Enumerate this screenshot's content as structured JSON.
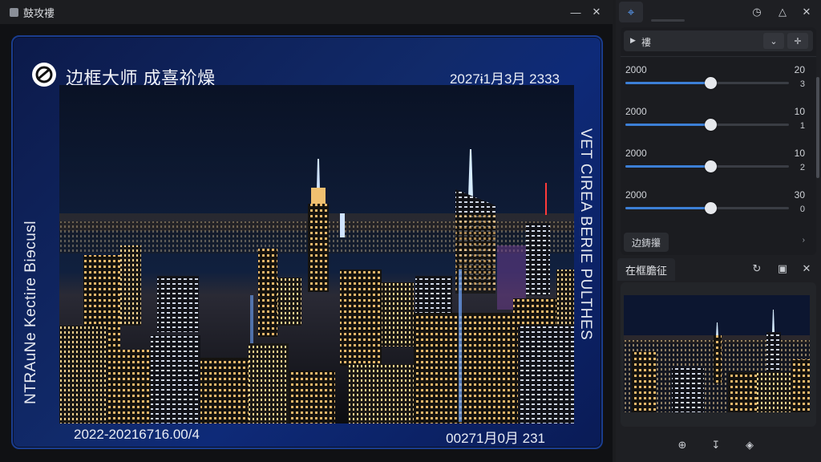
{
  "window": {
    "title": "鼓攻褸",
    "minimize_icon": "minimize-icon",
    "close_icon": "close-icon"
  },
  "frame": {
    "title": "边框大师 成喜祄燥",
    "date_top_right": "2027ɨ1月3月 2333",
    "date_bottom_left": "2022-20216716.00/4",
    "date_bottom_right": "00271月0月 231",
    "vertical_left": "NTRAuNe Kectire Biɘcusl",
    "vertical_right": "VET CIREA BERIE PULTHES",
    "frame_color": "#112a6a",
    "accent_color": "#3c7fd6"
  },
  "side": {
    "tab_icon": "frame-grid-icon",
    "top_icons": [
      "history-icon",
      "graduation-cap-icon",
      "close-icon"
    ],
    "dropdown": {
      "label": "褸",
      "icon": "play-icon",
      "button_icons": [
        "chevron-down-icon",
        "pin-icon"
      ]
    },
    "sliders": [
      {
        "left_label": "2000",
        "right_label": "20",
        "value_label": "3",
        "fraction": 0.52
      },
      {
        "left_label": "2000",
        "right_label": "10",
        "value_label": "1",
        "fraction": 0.52
      },
      {
        "left_label": "2000",
        "right_label": "10",
        "value_label": "2",
        "fraction": 0.52
      },
      {
        "left_label": "2000",
        "right_label": "30",
        "value_label": "0",
        "fraction": 0.52
      }
    ],
    "more_button": "边鋳攥",
    "more_arrow": "›"
  },
  "preview": {
    "tab_label": "在框膽征",
    "header_icons": [
      "refresh-icon",
      "crop-icon",
      "close-icon"
    ]
  },
  "bottom_tools": [
    "zoom-in-icon",
    "download-icon",
    "layers-icon"
  ]
}
